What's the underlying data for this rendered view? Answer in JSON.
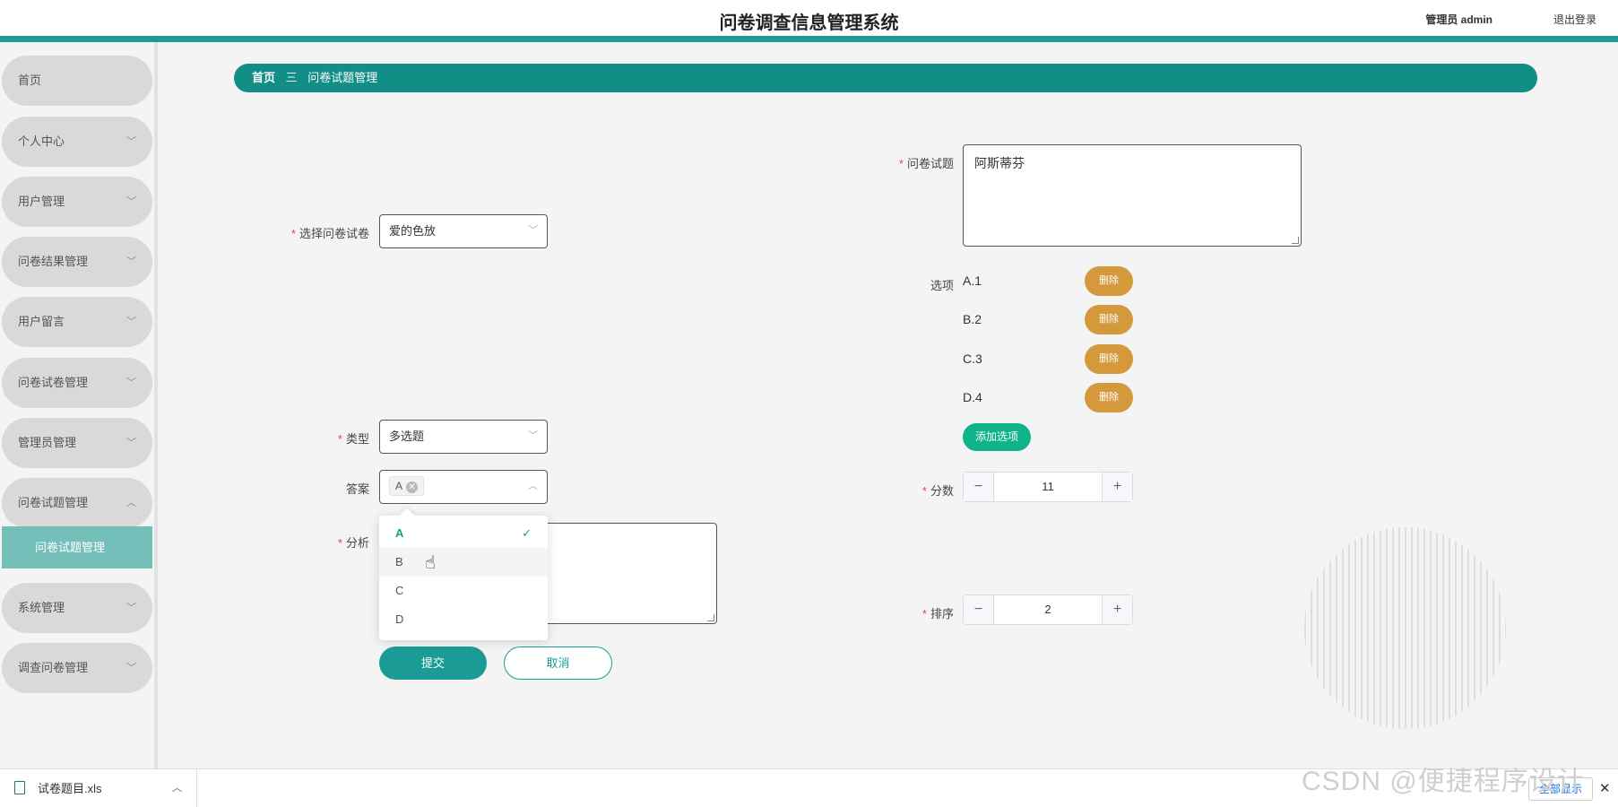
{
  "header": {
    "title": "问卷调查信息管理系统",
    "user": "管理员 admin",
    "logout": "退出登录",
    "accent_color": "#1c9a93"
  },
  "sidebar": {
    "items": [
      {
        "label": "首页"
      },
      {
        "label": "个人中心"
      },
      {
        "label": "用户管理"
      },
      {
        "label": "问卷结果管理"
      },
      {
        "label": "用户留言"
      },
      {
        "label": "问卷试卷管理"
      },
      {
        "label": "管理员管理"
      },
      {
        "label": "问卷试题管理",
        "expanded": true
      },
      {
        "label": "系统管理"
      },
      {
        "label": "调查问卷管理"
      }
    ],
    "active_sub": "问卷试题管理"
  },
  "breadcrumb": {
    "home": "首页",
    "separator": "三",
    "current": "问卷试题管理"
  },
  "form": {
    "paper": {
      "label": "选择问卷试卷",
      "value": "爱的色放"
    },
    "type": {
      "label": "类型",
      "value": "多选题"
    },
    "answer": {
      "label": "答案",
      "tag": "A",
      "options": [
        "A",
        "B",
        "C",
        "D"
      ],
      "selected": "A"
    },
    "analysis": {
      "label": "分析",
      "value": ""
    },
    "question": {
      "label": "问卷试题",
      "value": "阿斯蒂芬"
    },
    "options_label": "选项",
    "options": [
      {
        "text": "A.1",
        "delete_label": "删除"
      },
      {
        "text": "B.2",
        "delete_label": "删除"
      },
      {
        "text": "C.3",
        "delete_label": "删除"
      },
      {
        "text": "D.4",
        "delete_label": "删除"
      }
    ],
    "add_option_label": "添加选项",
    "score": {
      "label": "分数",
      "value": "11"
    },
    "order": {
      "label": "排序",
      "value": "2"
    },
    "submit_label": "提交",
    "cancel_label": "取消"
  },
  "downloads": {
    "file_name": "试卷题目.xls",
    "show_all": "全部显示"
  },
  "watermark": "CSDN @便捷程序设计"
}
